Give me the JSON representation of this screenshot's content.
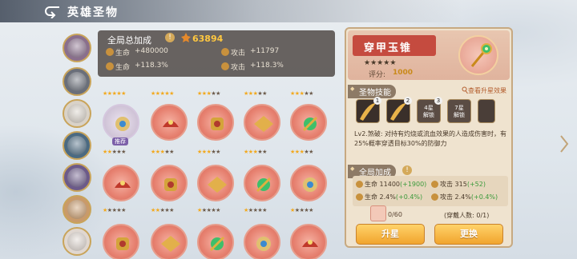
{
  "header": {
    "title": "英雄圣物"
  },
  "global_bonus": {
    "title": "全局总加成",
    "info": "!",
    "power": "63894",
    "stats": [
      {
        "label": "生命",
        "value": "+480000"
      },
      {
        "label": "攻击",
        "value": "+11797"
      },
      {
        "label": "生命",
        "value": "+118.3%"
      },
      {
        "label": "攻击",
        "value": "+118.3%"
      }
    ]
  },
  "grid": {
    "recommend_badge": "推荐",
    "rows": [
      {
        "stars": [
          5,
          5,
          3,
          3,
          3
        ]
      },
      {
        "stars": [
          2,
          3,
          3,
          3,
          3
        ]
      },
      {
        "stars": [
          1,
          2,
          1,
          1,
          1
        ]
      }
    ]
  },
  "detail": {
    "name": "穿甲玉锥",
    "stars": 2,
    "max_stars": 5,
    "score_label": "评分:",
    "score": "1000",
    "skills_title": "圣物技能",
    "upgrade_link": "查看升星效果",
    "skills": [
      {
        "num": "1",
        "lock": ""
      },
      {
        "num": "2",
        "lock": ""
      },
      {
        "num": "3",
        "lock": "4星\n解锁"
      },
      {
        "num": "",
        "lock": "7星\n解锁"
      }
    ],
    "description": "Lv2.煞破: 对持有灼烧或流血效果的人造成伤害时，有25%概率穿透目标30%的防御力",
    "global_title": "全局加成",
    "global_info": "!",
    "stats": [
      {
        "label": "生命",
        "value": "11400",
        "bonus": "(+1900)"
      },
      {
        "label": "攻击",
        "value": "315",
        "bonus": "(+52)"
      },
      {
        "label": "生命",
        "value": "2.4%",
        "bonus": "(+0.4%)"
      },
      {
        "label": "攻击",
        "value": "2.4%",
        "bonus": "(+0.4%)"
      }
    ],
    "material_count": "0/60",
    "wearers": "(穿戴人数: 0/1)",
    "upgrade_btn": "升星",
    "replace_btn": "更换"
  },
  "colors": {
    "accent": "#f1a42d",
    "panel": "#efe3cf",
    "title_plate": "#c54b3f",
    "bonus_green": "#3b9a3b"
  }
}
